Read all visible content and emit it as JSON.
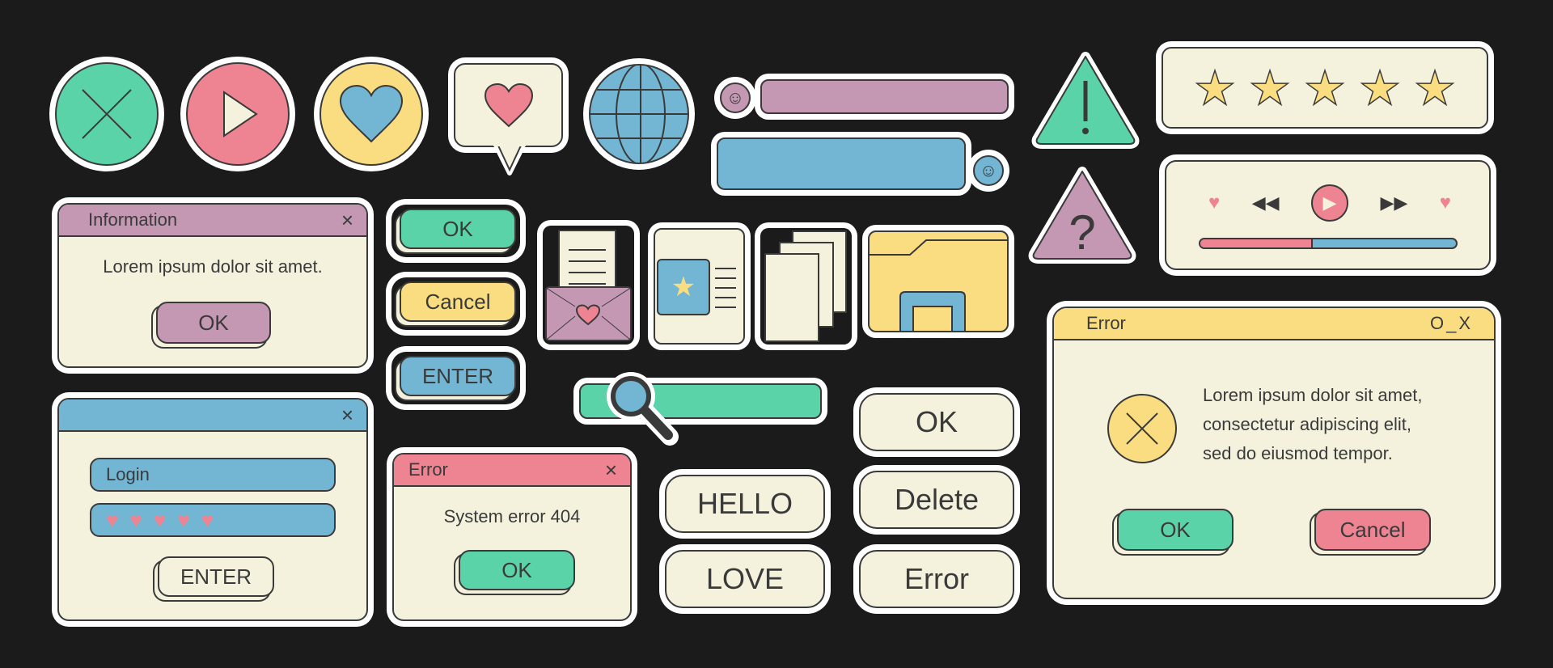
{
  "colors": {
    "background": "#1b1b1b",
    "green": "#5bd3a9",
    "pink": "#ee8392",
    "yellow": "#fadd80",
    "blue": "#72b6d4",
    "purple": "#c497b3",
    "cream": "#f4f2dd",
    "outline": "#3a3a3a"
  },
  "icons": [
    "close-circle-icon",
    "play-circle-icon",
    "heart-circle-icon",
    "heart-speech-bubble-icon",
    "globe-icon",
    "smiley-icon",
    "warning-icon",
    "question-icon",
    "star-icon",
    "envelope-icon",
    "document-star-icon",
    "documents-icon",
    "folder-icon",
    "search-icon"
  ],
  "rating": {
    "stars": 5,
    "max": 5
  },
  "player": {
    "progress": 0.44
  },
  "info_dialog": {
    "title": "Information",
    "close": "×",
    "message": "Lorem ipsum dolor sit amet.",
    "ok": "OK"
  },
  "buttons": {
    "ok": "OK",
    "cancel": "Cancel",
    "enter": "ENTER"
  },
  "login_dialog": {
    "close": "×",
    "login_field": "Login",
    "password_hearts": 5,
    "enter": "ENTER"
  },
  "small_error": {
    "title": "Error",
    "close": "×",
    "message": "System error 404",
    "ok": "OK"
  },
  "bubbles": {
    "hello": "HELLO",
    "love": "LOVE"
  },
  "big_buttons": {
    "ok": "OK",
    "delete": "Delete",
    "error": "Error"
  },
  "big_error": {
    "title": "Error",
    "controls": "O_X",
    "message_lines": [
      "Lorem ipsum dolor sit amet,",
      "consectetur adipiscing elit,",
      "sed do eiusmod tempor."
    ],
    "ok": "OK",
    "cancel": "Cancel"
  }
}
